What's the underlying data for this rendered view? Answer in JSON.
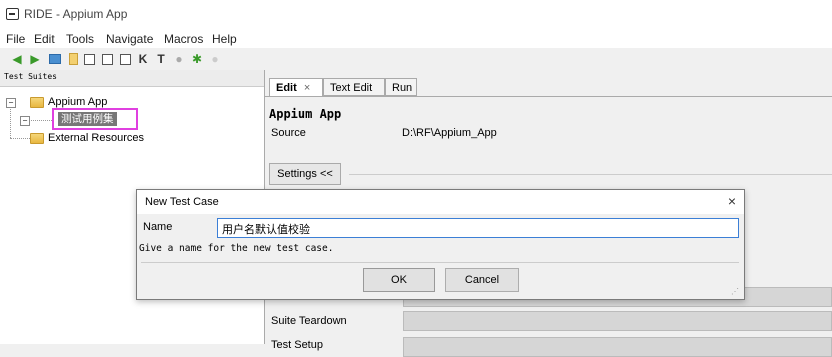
{
  "window": {
    "title": "RIDE - Appium App"
  },
  "menu": [
    "File",
    "Edit",
    "Tools",
    "Navigate",
    "Macros",
    "Help"
  ],
  "toolbar": {
    "icons": [
      "back-arrow-icon",
      "forward-arrow-icon",
      "open-folder-icon",
      "new-file-icon",
      "save-icon",
      "save-all-icon",
      "save-as-icon",
      "keyword-icon",
      "testcase-icon",
      "play-icon",
      "bug-icon",
      "stop-icon"
    ]
  },
  "left_panel": {
    "header": "Test Suites",
    "tree": {
      "root": "Appium App",
      "selected_child": "测试用例集",
      "external": "External Resources"
    }
  },
  "editor": {
    "tabs": [
      {
        "label": "Edit",
        "close": "×"
      },
      {
        "label": "Text Edit"
      },
      {
        "label": "Run"
      }
    ],
    "suite_name": "Appium App",
    "source_label": "Source",
    "source_value": "D:\\RF\\Appium_App",
    "settings_button": "Settings <<",
    "fields": [
      "Suite Teardown",
      "Test Setup"
    ]
  },
  "dialog": {
    "title": "New Test Case",
    "close": "×",
    "name_label": "Name",
    "name_value": "用户名默认值校验",
    "hint": "Give a name for the new test case.",
    "ok": "OK",
    "cancel": "Cancel"
  },
  "colors": {
    "highlight_box": "#e040e0",
    "input_focus": "#3c7fd6"
  }
}
